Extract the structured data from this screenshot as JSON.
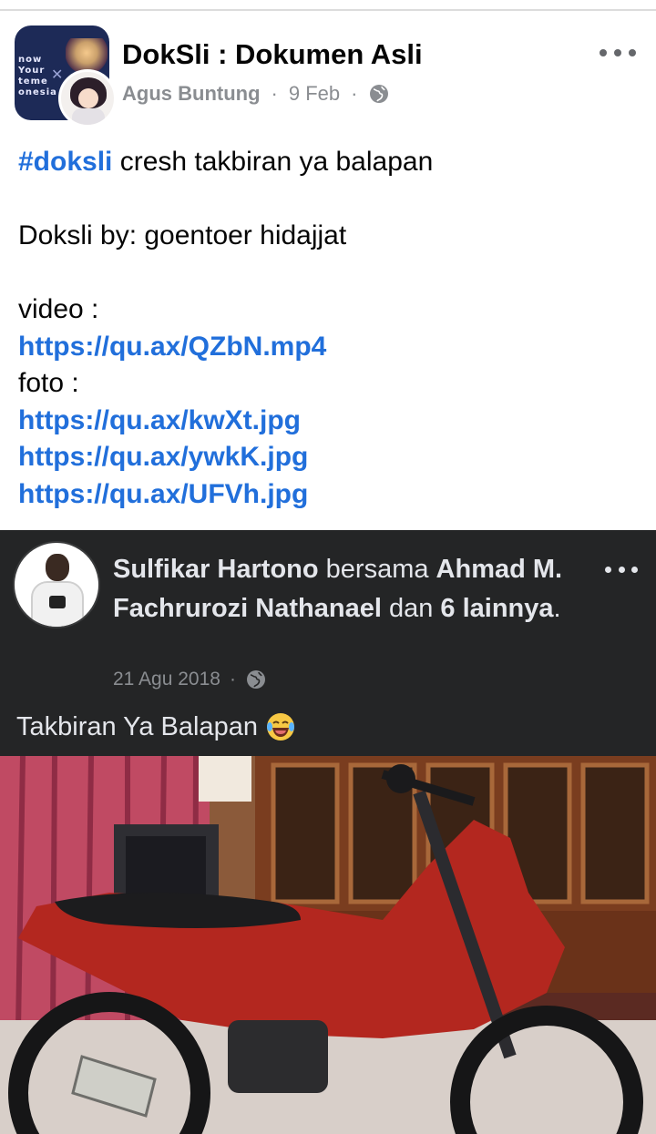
{
  "group": {
    "name": "DokSli : Dokumen Asli",
    "avatar_text": [
      "now",
      "Your",
      "teme",
      "onesia"
    ]
  },
  "post": {
    "author": "Agus Buntung",
    "date": "9 Feb",
    "separator": "·",
    "hashtag": "#doksli",
    "first_line_rest": " cresh takbiran ya balapan",
    "credit": "Doksli by: goentoer hidajjat",
    "video_label": "video :",
    "video_link": "https://qu.ax/QZbN.mp4",
    "photo_label": "foto :",
    "photo_links": [
      "https://qu.ax/kwXt.jpg",
      "https://qu.ax/ywkK.jpg",
      "https://qu.ax/UFVh.jpg"
    ]
  },
  "embedded": {
    "author": "Sulfikar Hartono",
    "with_word": " bersama ",
    "tagged": "Ahmad M. Fachrurozi Nathanael",
    "and_word": " dan ",
    "others_count": "6 lainnya",
    "period": ".",
    "date": "21 Agu 2018",
    "separator": "·",
    "caption": "Takbiran Ya Balapan"
  },
  "icons": {
    "more": "more-options-icon",
    "privacy": "globe-icon",
    "emoji": "tears-of-joy-emoji-icon"
  },
  "colors": {
    "link": "#216fdb",
    "muted": "#8a8d91",
    "embed_bg": "#242526"
  }
}
